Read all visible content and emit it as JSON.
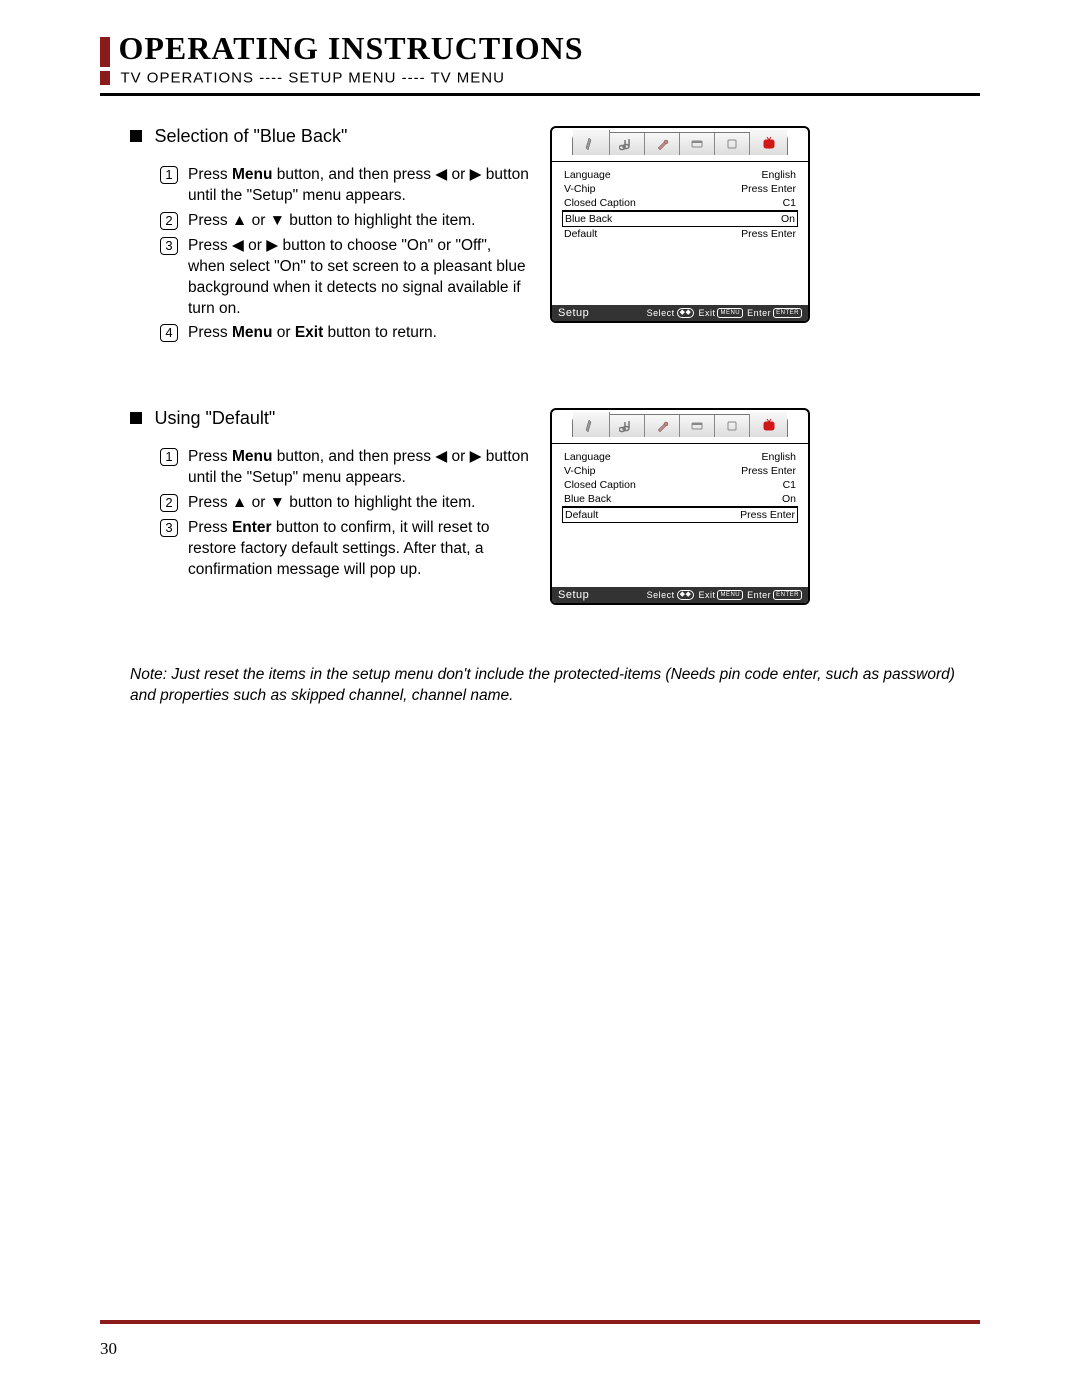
{
  "header": {
    "title": "OPERATING INSTRUCTIONS",
    "breadcrumb": "TV OPERATIONS ---- SETUP MENU ---- TV MENU"
  },
  "section1": {
    "title": "Selection of \"Blue Back\"",
    "steps": {
      "s1a": "Press ",
      "s1b": "Menu",
      "s1c": " button, and then press ◀ or ▶ button until the \"Setup\" menu appears.",
      "s2": "Press ▲ or ▼ button to highlight the item.",
      "s3": "Press ◀ or ▶ button to choose \"On\" or \"Off\", when select \"On\" to set screen to a pleasant blue background when it detects no signal available if turn on.",
      "s4a": "Press ",
      "s4b": "Menu",
      "s4c": " or ",
      "s4d": "Exit",
      "s4e": " button to return."
    }
  },
  "section2": {
    "title": "Using \"Default\"",
    "steps": {
      "s1a": "Press ",
      "s1b": "Menu",
      "s1c": " button, and then press ◀ or ▶ button until the \"Setup\" menu appears.",
      "s2": "Press ▲ or ▼ button to highlight the item.",
      "s3a": "Press ",
      "s3b": "Enter",
      "s3c": " button to confirm, it will reset to restore factory default settings. After that, a confirmation message will pop up."
    }
  },
  "osd": {
    "tabs": [
      "brush",
      "music",
      "wrench",
      "window",
      "box",
      "tv"
    ],
    "rows": {
      "language_label": "Language",
      "language_value": "English",
      "vchip_label": "V-Chip",
      "vchip_value": "Press Enter",
      "cc_label": "Closed Caption",
      "cc_value": "C1",
      "blueback_label": "Blue Back",
      "blueback_value": "On",
      "default_label": "Default",
      "default_value": "Press Enter"
    },
    "footer": {
      "title": "Setup",
      "select": "Select",
      "exit": "Exit",
      "enter": "Enter",
      "menu_key": "MENU",
      "enter_key": "ENTER"
    }
  },
  "note": "Note: Just reset the items in the setup menu don't include the protected-items (Needs pin code enter, such as password) and properties such as skipped channel, channel name.",
  "page_number": "30"
}
